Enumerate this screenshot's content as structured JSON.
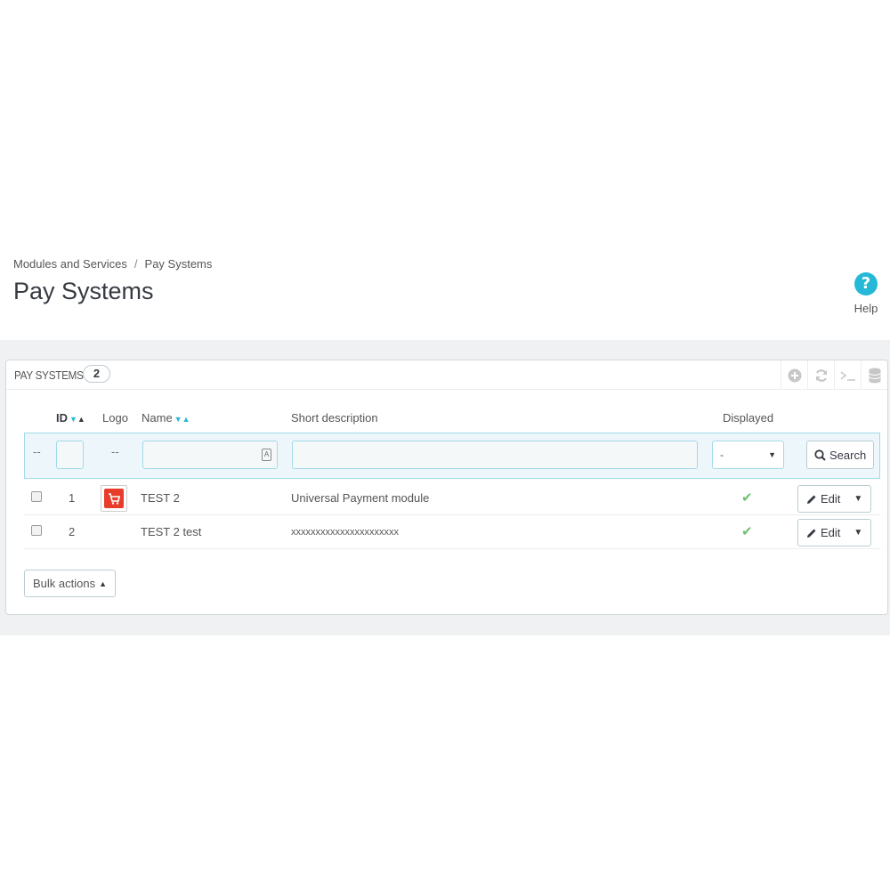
{
  "breadcrumb": {
    "parent": "Modules and Services",
    "separator": "/",
    "current": "Pay Systems"
  },
  "page": {
    "title": "Pay Systems",
    "help_label": "Help",
    "help_icon": "question-circle-icon"
  },
  "panel": {
    "title": "Pay Systems",
    "count": "2",
    "toolbar": [
      "add-new-icon",
      "refresh-icon",
      "sql-query-icon",
      "export-database-icon"
    ]
  },
  "table": {
    "columns": {
      "id": "ID",
      "logo": "Logo",
      "name": "Name",
      "description": "Short description",
      "displayed": "Displayed"
    },
    "filters": {
      "dash": "--",
      "displayed_value": "-",
      "search_label": "Search"
    },
    "rows": [
      {
        "id": "1",
        "name": "TEST 2",
        "description": "Universal Payment module",
        "displayed": true,
        "has_logo": true,
        "edit": "Edit"
      },
      {
        "id": "2",
        "name": "TEST 2 test",
        "description": "xxxxxxxxxxxxxxxxxxxxxx",
        "displayed": true,
        "has_logo": false,
        "edit": "Edit"
      }
    ]
  },
  "bulk": {
    "label": "Bulk actions"
  },
  "colors": {
    "accent": "#25b9d7",
    "logo_red": "#e83d2b",
    "check_green": "#6ec16e"
  }
}
